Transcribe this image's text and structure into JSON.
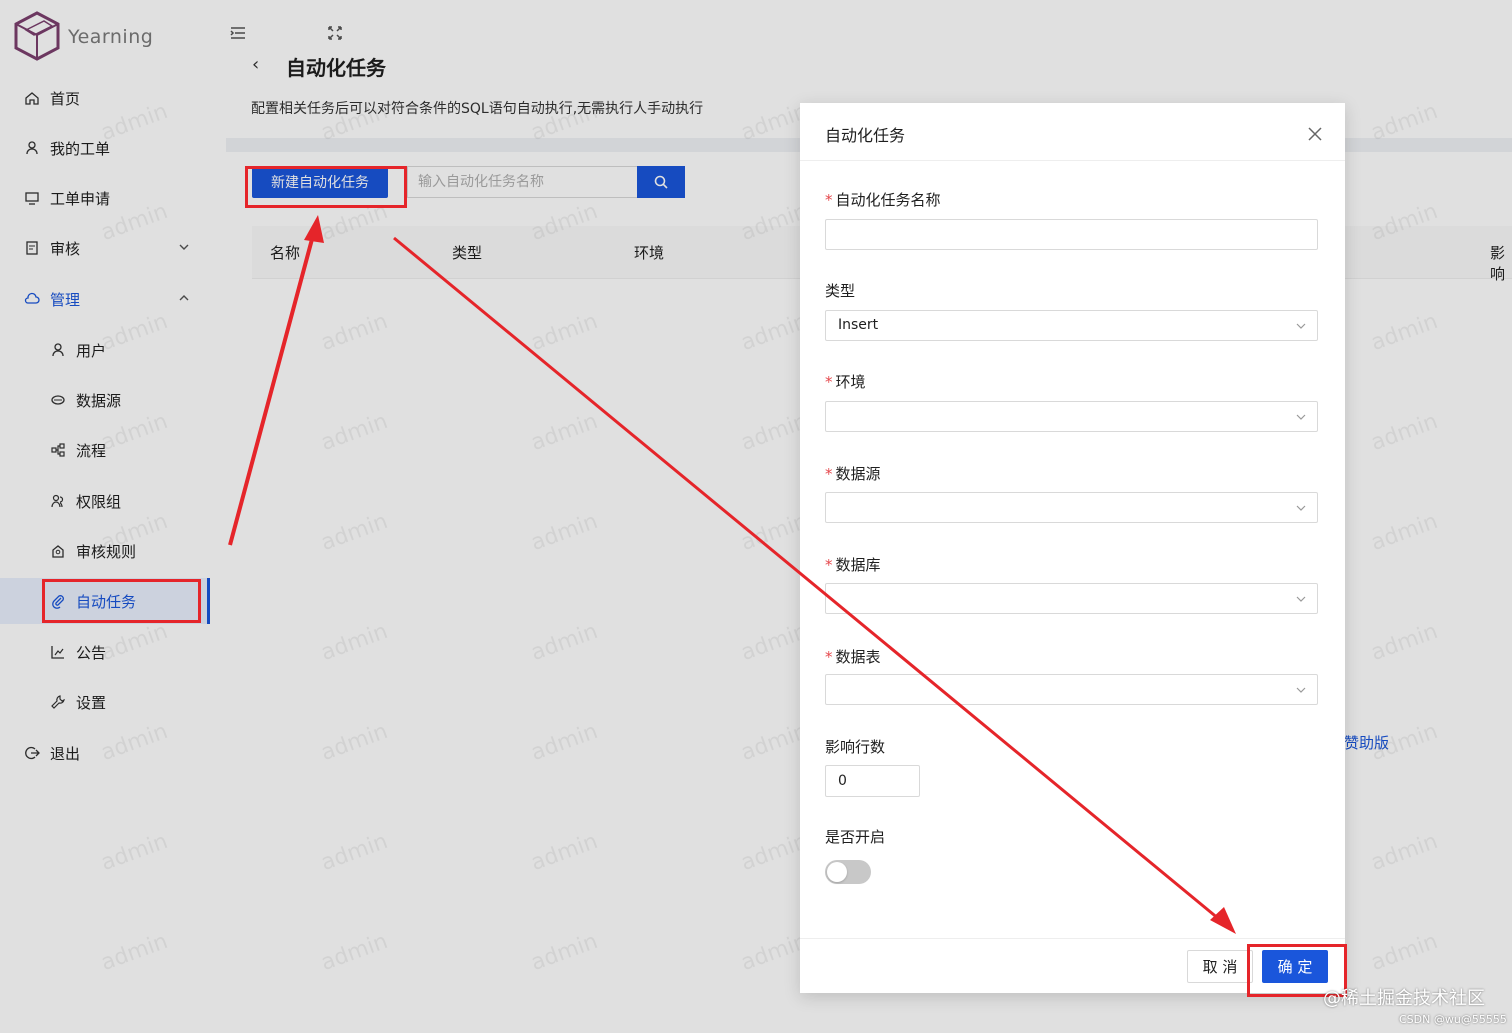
{
  "app": {
    "brand": "Yearning"
  },
  "sidebar": {
    "items": [
      {
        "label": "首页"
      },
      {
        "label": "我的工单"
      },
      {
        "label": "工单申请"
      },
      {
        "label": "审核"
      },
      {
        "label": "管理"
      },
      {
        "label": "用户"
      },
      {
        "label": "数据源"
      },
      {
        "label": "流程"
      },
      {
        "label": "权限组"
      },
      {
        "label": "审核规则"
      },
      {
        "label": "自动任务"
      },
      {
        "label": "公告"
      },
      {
        "label": "设置"
      },
      {
        "label": "退出"
      }
    ]
  },
  "page": {
    "title": "自动化任务",
    "description": "配置相关任务后可以对符合条件的SQL语句自动执行,无需执行人手动执行",
    "new_button": "新建自动化任务",
    "search_placeholder": "输入自动化任务名称",
    "columns": [
      "名称",
      "类型",
      "环境",
      "影响"
    ],
    "pager_text": "赞助版"
  },
  "modal": {
    "title": "自动化任务",
    "fields": {
      "name": {
        "label": "自动化任务名称",
        "required": "*"
      },
      "type": {
        "label": "类型",
        "value": "Insert"
      },
      "env": {
        "label": "环境",
        "required": "*"
      },
      "source": {
        "label": "数据源",
        "required": "*"
      },
      "database": {
        "label": "数据库",
        "required": "*"
      },
      "table": {
        "label": "数据表",
        "required": "*"
      },
      "rows": {
        "label": "影响行数",
        "value": "0"
      },
      "enabled": {
        "label": "是否开启",
        "on": false
      }
    },
    "cancel": "取 消",
    "ok": "确 定"
  },
  "watermark": "admin",
  "credits": {
    "line1": "@稀土掘金技术社区",
    "line2": "CSDN @wu@55555"
  },
  "colors": {
    "primary": "#1a56db",
    "annotation": "#e5252a"
  }
}
